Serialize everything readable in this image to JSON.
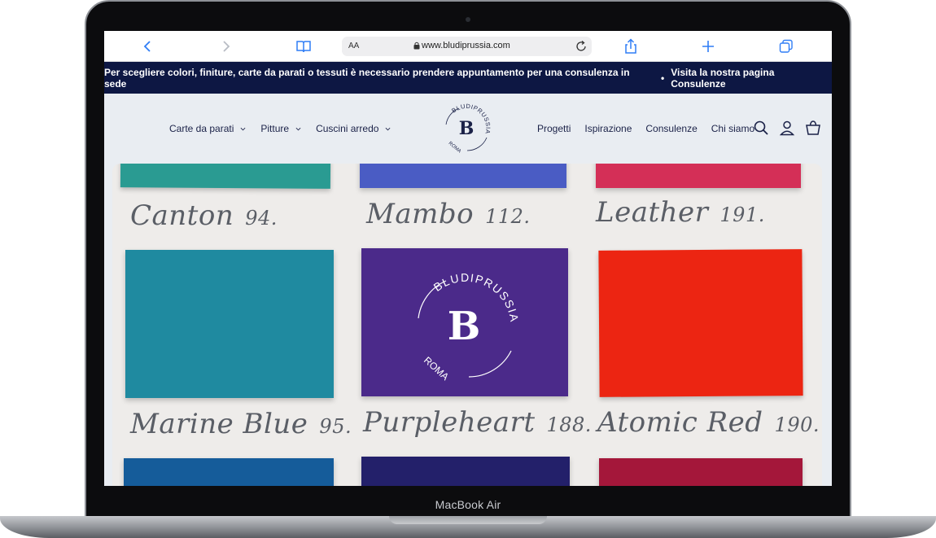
{
  "device": {
    "label": "MacBook Air"
  },
  "browser": {
    "reader_label": "AA",
    "url": "www.bludiprussia.com",
    "icons": [
      "chevron-left-icon",
      "chevron-right-icon",
      "book-icon",
      "lock-icon",
      "reload-icon",
      "share-icon",
      "plus-icon",
      "tabs-icon"
    ]
  },
  "announcement": {
    "text": "Per scegliere colori, finiture, carte da parati o tessuti è necessario prendere appuntamento per una consulenza in sede",
    "separator": "•",
    "link": "Visita la nostra pagina Consulenze"
  },
  "header": {
    "nav_left": [
      {
        "label": "Carte da parati"
      },
      {
        "label": "Pitture"
      },
      {
        "label": "Cuscini arredo"
      }
    ],
    "nav_right": [
      {
        "label": "Progetti"
      },
      {
        "label": "Ispirazione"
      },
      {
        "label": "Consulenze"
      },
      {
        "label": "Chi siamo"
      }
    ],
    "logo": {
      "name": "BLUDIPRUSSIA",
      "city": "ROMA",
      "mark": "B"
    },
    "icons": [
      "search-icon",
      "account-icon",
      "cart-icon"
    ]
  },
  "hero": {
    "labels": [
      {
        "name": "Canton",
        "number": "94."
      },
      {
        "name": "Mambo",
        "number": "112."
      },
      {
        "name": "Leather",
        "number": "191."
      },
      {
        "name": "Marine Blue",
        "number": "95."
      },
      {
        "name": "Purpleheart",
        "number": "188."
      },
      {
        "name": "Atomic Red",
        "number": "190."
      }
    ],
    "colors": {
      "canton": "#2a9b92",
      "mambo": "#4a5cc4",
      "leather": "#d42f57",
      "marine_blue": "#1f8aa0",
      "purpleheart": "#4b2a8a",
      "atomic_red": "#ec2512",
      "row3_left": "#155c9a",
      "row3_mid": "#23206a",
      "row3_right": "#a4173a"
    }
  },
  "colors": {
    "navy": "#0d1743",
    "header_bg": "#e9edf2",
    "accent": "#2f7df6"
  }
}
